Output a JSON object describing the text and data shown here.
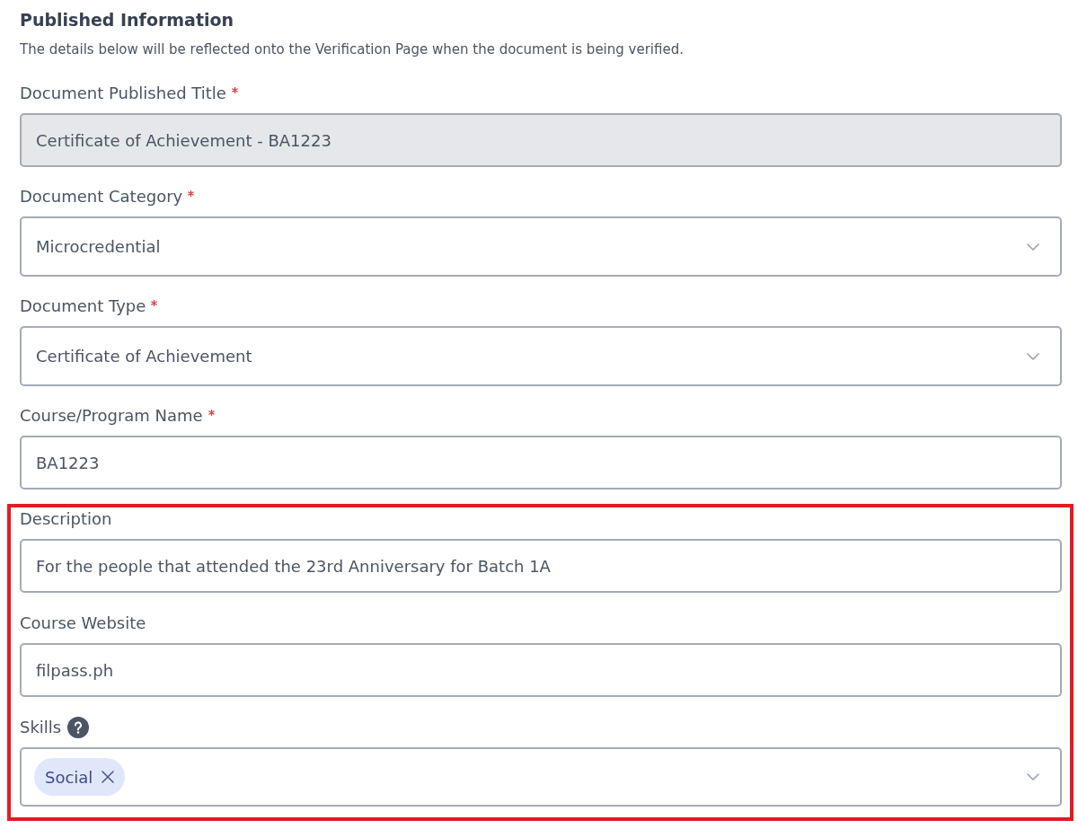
{
  "section": {
    "title": "Published Information",
    "subtitle": "The details below will be reflected onto the Verification Page when the document is being verified."
  },
  "fields": [
    {
      "kind": "text",
      "label": "Document Published Title",
      "required": true,
      "help": false,
      "disabled": true,
      "highlighted": false,
      "value": "Certificate of Achievement - BA1223"
    },
    {
      "kind": "select",
      "label": "Document Category",
      "required": true,
      "help": false,
      "disabled": false,
      "highlighted": false,
      "value": "Microcredential"
    },
    {
      "kind": "select",
      "label": "Document Type",
      "required": true,
      "help": false,
      "disabled": false,
      "highlighted": false,
      "value": "Certificate of Achievement"
    },
    {
      "kind": "text",
      "label": "Course/Program Name",
      "required": true,
      "help": false,
      "disabled": false,
      "highlighted": false,
      "value": "BA1223"
    },
    {
      "kind": "text",
      "label": "Description",
      "required": false,
      "help": false,
      "disabled": false,
      "highlighted": true,
      "value": "For the people that attended the 23rd Anniversary for Batch 1A"
    },
    {
      "kind": "text",
      "label": "Course Website",
      "required": false,
      "help": false,
      "disabled": false,
      "highlighted": true,
      "value": "filpass.ph"
    },
    {
      "kind": "tags",
      "label": "Skills",
      "required": false,
      "help": true,
      "disabled": false,
      "highlighted": true,
      "tags": [
        "Social"
      ]
    }
  ]
}
